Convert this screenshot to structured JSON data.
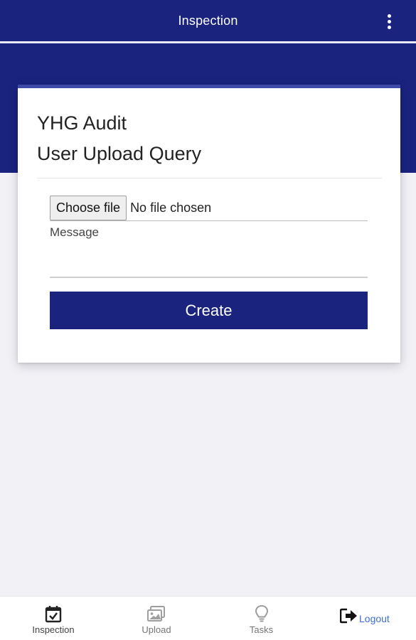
{
  "app_bar": {
    "title": "Inspection",
    "menu_icon": "more-vert-icon"
  },
  "card": {
    "title_line1": "YHG Audit",
    "title_line2": "User Upload Query",
    "file_input": {
      "button_label": "Choose file",
      "status_text": "No file chosen"
    },
    "message": {
      "label": "Message",
      "value": "",
      "placeholder": ""
    },
    "create_label": "Create"
  },
  "bottom_nav": {
    "items": [
      {
        "label": "Inspection",
        "icon": "calendar-check-icon",
        "active": true
      },
      {
        "label": "Upload",
        "icon": "images-icon"
      },
      {
        "label": "Tasks",
        "icon": "lightbulb-icon"
      },
      {
        "label": "Logout",
        "icon": "sign-out-icon"
      }
    ]
  },
  "colors": {
    "primary": "#1a237e",
    "background": "#f1f1f6",
    "logout_link": "#3f6fd6"
  }
}
